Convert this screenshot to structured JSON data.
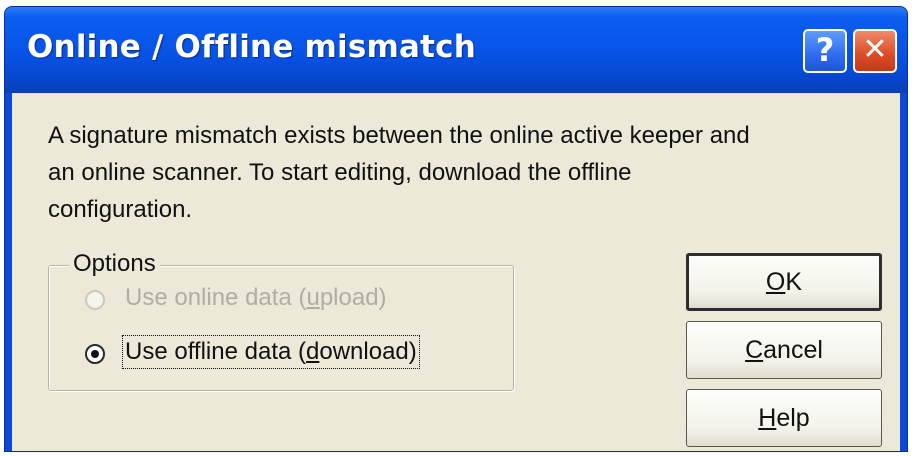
{
  "window": {
    "title": "Online / Offline mismatch",
    "help_glyph": "?",
    "close_glyph": "✕"
  },
  "message": {
    "line1": "A signature mismatch exists between the online active keeper and",
    "line2": "an online scanner. To start editing, download the offline",
    "line3": "configuration."
  },
  "options": {
    "label": "Options",
    "items": [
      {
        "label_pre": "Use online data (",
        "label_key": "u",
        "label_post": "pload)",
        "selected": false,
        "enabled": false
      },
      {
        "label_pre": "Use offline data (",
        "label_key": "d",
        "label_post": "ownload)",
        "selected": true,
        "enabled": true
      }
    ]
  },
  "buttons": {
    "ok_key": "O",
    "ok_rest": "K",
    "cancel_key": "C",
    "cancel_rest": "ancel",
    "help_key": "H",
    "help_rest": "elp"
  },
  "colors": {
    "titlebar": "#0753e6",
    "dialog_bg": "#ece9d8",
    "close_button": "#dc4b26",
    "disabled_text": "#b0ae9f"
  }
}
